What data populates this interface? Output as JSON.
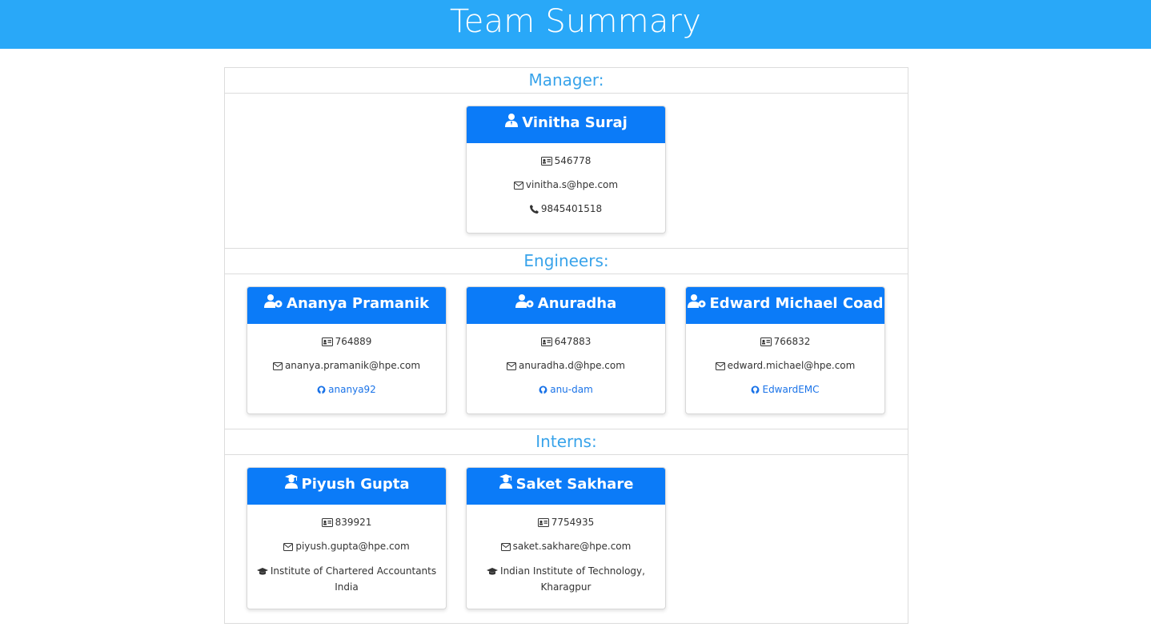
{
  "page": {
    "title": "Team Summary"
  },
  "colors": {
    "header_bg": "#29a8f8",
    "card_head_bg": "#0b7bf8",
    "section_title": "#38a3ea",
    "link": "#1a73e8"
  },
  "sections": {
    "manager": {
      "title": "Manager:"
    },
    "engineers": {
      "title": "Engineers:"
    },
    "interns": {
      "title": "Interns:"
    }
  },
  "manager": {
    "name": "Vinitha Suraj",
    "id": "546778",
    "email": "vinitha.s@hpe.com",
    "phone": "9845401518",
    "role_icon": "manager-icon"
  },
  "engineers": [
    {
      "name": "Ananya Pramanik",
      "id": "764889",
      "email": "ananya.pramanik@hpe.com",
      "github": "ananya92",
      "role_icon": "engineer-icon"
    },
    {
      "name": "Anuradha",
      "id": "647883",
      "email": "anuradha.d@hpe.com",
      "github": "anu-dam",
      "role_icon": "engineer-icon"
    },
    {
      "name": "Edward Michael Coad",
      "id": "766832",
      "email": "edward.michael@hpe.com",
      "github": "EdwardEMC",
      "role_icon": "engineer-icon"
    }
  ],
  "interns": [
    {
      "name": "Piyush Gupta",
      "id": "839921",
      "email": "piyush.gupta@hpe.com",
      "school": "Institute of Chartered Accountants India",
      "role_icon": "intern-icon"
    },
    {
      "name": "Saket Sakhare",
      "id": "7754935",
      "email": "saket.sakhare@hpe.com",
      "school": "Indian Institute of Technology, Kharagpur",
      "role_icon": "intern-icon"
    }
  ]
}
